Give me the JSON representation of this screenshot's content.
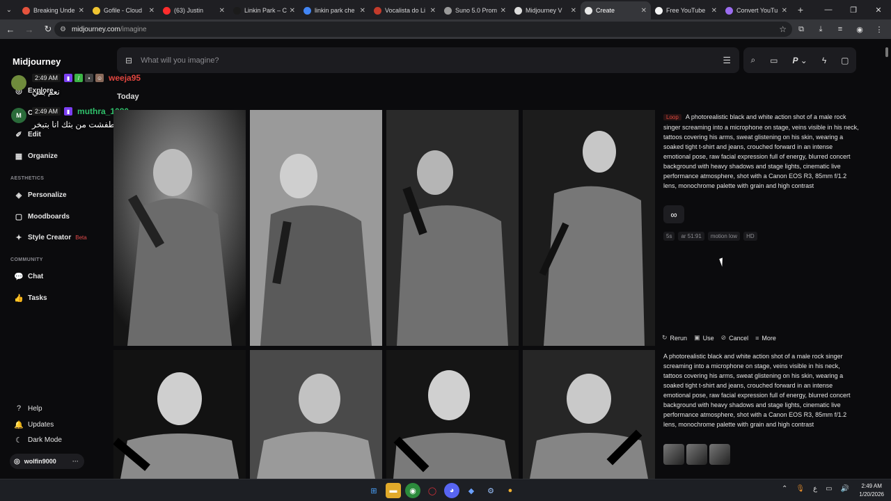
{
  "browser": {
    "tabs": [
      {
        "title": "Breaking Unde",
        "fav_color": "#e5533d"
      },
      {
        "title": "Gofile - Cloud",
        "fav_color": "#f0c431"
      },
      {
        "title": "(63) Justin",
        "fav_color": "#ff2d2d"
      },
      {
        "title": "Linkin Park – C",
        "fav_color": "#1b1b1b"
      },
      {
        "title": "linkin park che",
        "fav_color": "#4285f4"
      },
      {
        "title": "Vocalista do Li",
        "fav_color": "#c33b2b"
      },
      {
        "title": "Suno 5.0 Prom",
        "fav_color": "#9a9a9a"
      },
      {
        "title": "Midjourney V",
        "fav_color": "#dddddd"
      },
      {
        "title": "Create",
        "fav_color": "#e8e8e8"
      },
      {
        "title": "Free YouTube",
        "fav_color": "#f4f4f4"
      },
      {
        "title": "Convert YouTu",
        "fav_color": "#9b6cf0"
      }
    ],
    "url_host": "midjourney.com",
    "url_path": "/imagine"
  },
  "sidebar": {
    "brand": "Midjourney",
    "items_top": [
      {
        "label": "Explore",
        "icon": "compass-icon"
      },
      {
        "label": "Create",
        "icon": "brush-icon"
      },
      {
        "label": "Edit",
        "icon": "edit-icon"
      },
      {
        "label": "Organize",
        "icon": "grid-icon"
      }
    ],
    "section_aesthetics": "AESTHETICS",
    "items_aesthetics": [
      {
        "label": "Personalize",
        "icon": "personalize-icon"
      },
      {
        "label": "Moodboards",
        "icon": "moodboard-icon"
      },
      {
        "label": "Style Creator",
        "icon": "style-icon",
        "badge": "Beta"
      }
    ],
    "section_community": "COMMUNITY",
    "items_community": [
      {
        "label": "Chat",
        "icon": "chat-icon"
      },
      {
        "label": "Tasks",
        "icon": "tasks-icon"
      }
    ],
    "items_bottom": [
      {
        "label": "Help",
        "icon": "help-icon"
      },
      {
        "label": "Updates",
        "icon": "bell-icon"
      },
      {
        "label": "Dark Mode",
        "icon": "moon-icon"
      }
    ],
    "user": "wolfin9000"
  },
  "chat_overlay": {
    "msg1": {
      "time": "2:49 AM",
      "user": "weeja95",
      "text": "نعم بقي",
      "user_color": "#e2463f"
    },
    "msg2": {
      "time": "2:49 AM",
      "user": "muthra_1080",
      "text": "اقول عاد طفشت من بثك انا بتبخر",
      "user_color": "#2fc06a"
    }
  },
  "prompt_bar": {
    "placeholder": "What will you imagine?"
  },
  "feed": {
    "day_label": "Today",
    "job1": {
      "tag": "Loop",
      "prompt": "A photorealistic black and white action shot of a male rock singer screaming into a microphone on stage, veins visible in his neck, tattoos covering his arms, sweat glistening on his skin, wearing a soaked tight t-shirt and jeans, crouched forward in an intense emotional pose, raw facial expression full of energy, blurred concert background with heavy shadows and stage lights, cinematic live performance atmosphere, shot with a Canon EOS R3, 85mm f/1.2 lens, monochrome palette with grain and high contrast",
      "params": [
        "5s",
        "ar 51:91",
        "motion low",
        "HD"
      ]
    },
    "actions": [
      "Rerun",
      "Use",
      "Cancel",
      "More"
    ],
    "job2": {
      "prompt": "A photorealistic black and white action shot of a male rock singer screaming into a microphone on stage, veins visible in his neck, tattoos covering his arms, sweat glistening on his skin, wearing a soaked tight t-shirt and jeans, crouched forward in an intense emotional pose, raw facial expression full of energy, blurred concert background with heavy shadows and stage lights, cinematic live performance atmosphere, shot with a Canon EOS R3, 85mm f/1.2 lens, monochrome palette with grain and high contrast"
    }
  },
  "taskbar": {
    "time": "2:49 AM",
    "date": "1/20/2026",
    "lang": "ع"
  }
}
